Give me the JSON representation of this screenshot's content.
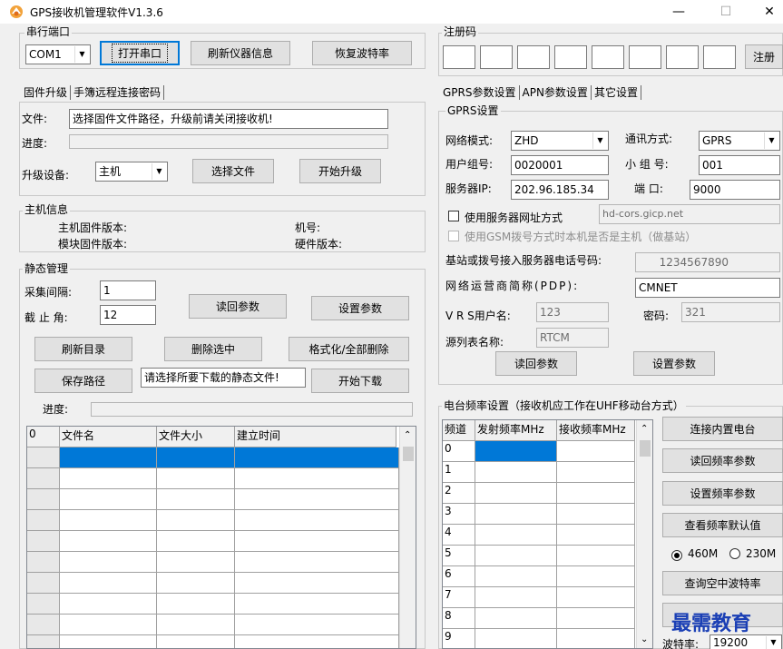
{
  "window": {
    "title": "GPS接收机管理软件V1.3.6",
    "minimize": "—",
    "maximize": "☐",
    "close": "✕"
  },
  "serial": {
    "group_label": "串行端口",
    "port": "COM1",
    "open_port": "打开串口",
    "refresh_info": "刷新仪器信息",
    "restore_baud": "恢复波特率"
  },
  "register": {
    "group_label": "注册码",
    "register_button": "注册"
  },
  "firmware": {
    "tabs": [
      "固件升级",
      "手簿远程连接密码"
    ],
    "file_label": "文件:",
    "file_value": "选择固件文件路径，升级前请关闭接收机!",
    "progress_label": "进度:",
    "progress": 0,
    "device_label": "升级设备:",
    "device": "主机",
    "choose_file": "选择文件",
    "start_upgrade": "开始升级"
  },
  "host_info": {
    "group_label": "主机信息",
    "host_fw": "主机固件版本:",
    "module_fw": "模块固件版本:",
    "device_no": "机号:",
    "hw_version": "硬件版本:"
  },
  "static": {
    "group_label": "静态管理",
    "interval_label": "采集间隔:",
    "interval": "1",
    "cutoff_label": "截 止 角:",
    "cutoff": "12",
    "read_params": "读回参数",
    "set_params": "设置参数",
    "refresh_dir": "刷新目录",
    "delete_selected": "删除选中",
    "format_all": "格式化/全部删除",
    "save_path": "保存路径",
    "save_hint": "请选择所要下载的静态文件!",
    "start_download": "开始下载",
    "progress_label": "进度:",
    "progress": 0,
    "table": {
      "corner": "0",
      "columns": [
        "文件名",
        "文件大小",
        "建立时间"
      ],
      "row_count": 10
    }
  },
  "gprs": {
    "tabs": [
      "GPRS参数设置",
      "APN参数设置",
      "其它设置"
    ],
    "group_label": "GPRS设置",
    "net_mode_label": "网络模式:",
    "net_mode": "ZHD",
    "comm_label": "通讯方式:",
    "comm": "GPRS",
    "user_group_label": "用户组号:",
    "user_group": "0020001",
    "sub_group_label": "小 组 号:",
    "sub_group": "001",
    "server_ip_label": "服务器IP:",
    "server_ip": "202.96.185.34",
    "port_label": "端  口:",
    "port": "9000",
    "use_domain_label": "使用服务器网址方式",
    "domain": "hd-cors.gicp.net",
    "gsm_label": "使用GSM拨号方式时本机是否是主机（做基站）",
    "dial_label": "基站或拨号接入服务器电话号码:",
    "dial": "1234567890",
    "pdp_label": "网络运营商简称(PDP):",
    "pdp": "CMNET",
    "vrs_user_label": "V R S用户名:",
    "vrs_user": "123",
    "password_label": "密码:",
    "password": "321",
    "source_label": "源列表名称:",
    "source": "RTCM",
    "read_params": "读回参数",
    "set_params": "设置参数"
  },
  "radio": {
    "group_label": "电台频率设置（接收机应工作在UHF移动台方式）",
    "columns": [
      "频道",
      "发射频率MHz",
      "接收频率MHz"
    ],
    "channels": [
      "0",
      "1",
      "2",
      "3",
      "4",
      "5",
      "6",
      "7",
      "8",
      "9"
    ],
    "connect_radio": "连接内置电台",
    "read_freq": "读回频率参数",
    "set_freq": "设置频率参数",
    "view_default": "查看频率默认值",
    "opt_460": "460M",
    "opt_230": "230M",
    "selected": "460M",
    "query_baud": "查询空中波特率",
    "baud_label": "波特率:",
    "baud": "19200"
  },
  "watermark": "最需教育"
}
